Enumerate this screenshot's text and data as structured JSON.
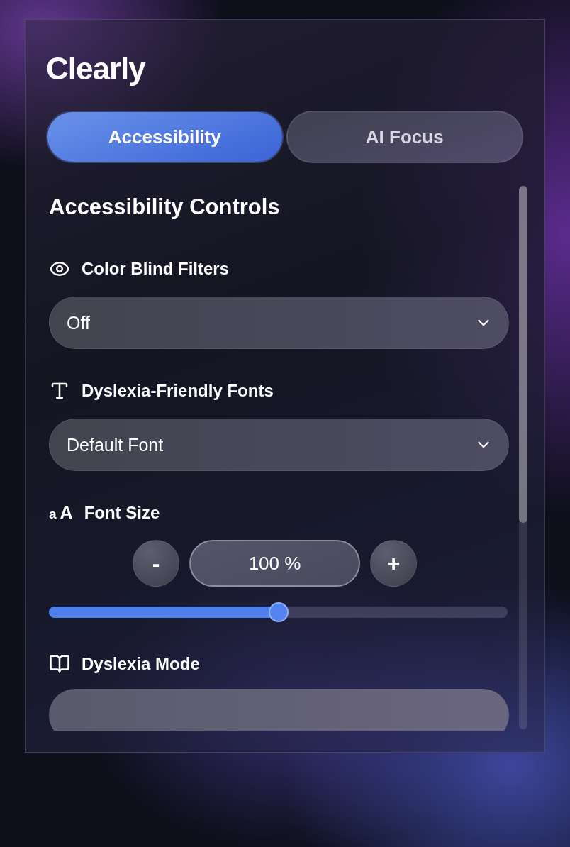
{
  "app": {
    "title": "Clearly"
  },
  "tabs": [
    {
      "label": "Accessibility",
      "selected": true
    },
    {
      "label": "AI Focus",
      "selected": false
    }
  ],
  "heading": "Accessibility Controls",
  "sections": [
    {
      "kind": "select",
      "label": "Color Blind Filters",
      "value": "Off"
    },
    {
      "kind": "select",
      "label": "Dyslexia-Friendly Fonts",
      "value": "Default Font"
    },
    {
      "kind": "stepper",
      "icon_small": "a",
      "icon_large": "A",
      "label": "Font Size",
      "minus": "-",
      "value": "100 %",
      "plus": "+",
      "level": 0.5
    },
    {
      "kind": "cut",
      "label": "Dyslexia Mode"
    }
  ]
}
